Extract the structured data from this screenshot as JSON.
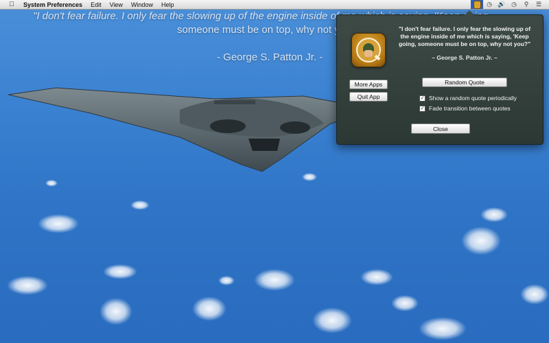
{
  "menubar": {
    "apple": "",
    "items": [
      "System Preferences",
      "Edit",
      "View",
      "Window",
      "Help"
    ],
    "tray_icons": [
      "quote-app-icon",
      "time-machine-icon",
      "volume-icon",
      "clock-icon",
      "spotlight-icon",
      "notification-list-icon"
    ]
  },
  "desktop_quote": {
    "line1": "\"I don't fear failure. I only fear the slowing up of the engine inside of me which is saying, 'Keep going,",
    "line2": "someone must be on top, why not you?\"",
    "author": "- George S. Patton Jr. -"
  },
  "popover": {
    "quote": "\"I don't fear failure. I only fear the slowing up of the engine inside of me which is saying, 'Keep going, someone must be on top, why not you?\"",
    "author": "– George S. Patton Jr. –",
    "buttons": {
      "more_apps": "More Apps",
      "quit_app": "Quit App",
      "random_quote": "Random Quote",
      "close": "Close"
    },
    "options": {
      "show_random": {
        "label": "Show a random quote periodically",
        "checked": true
      },
      "fade": {
        "label": "Fade transition between quotes",
        "checked": true
      }
    }
  },
  "colors": {
    "sky": "#3b82d2",
    "popover_bg": "#34403c",
    "tray_highlight": "#2f5fb8"
  }
}
